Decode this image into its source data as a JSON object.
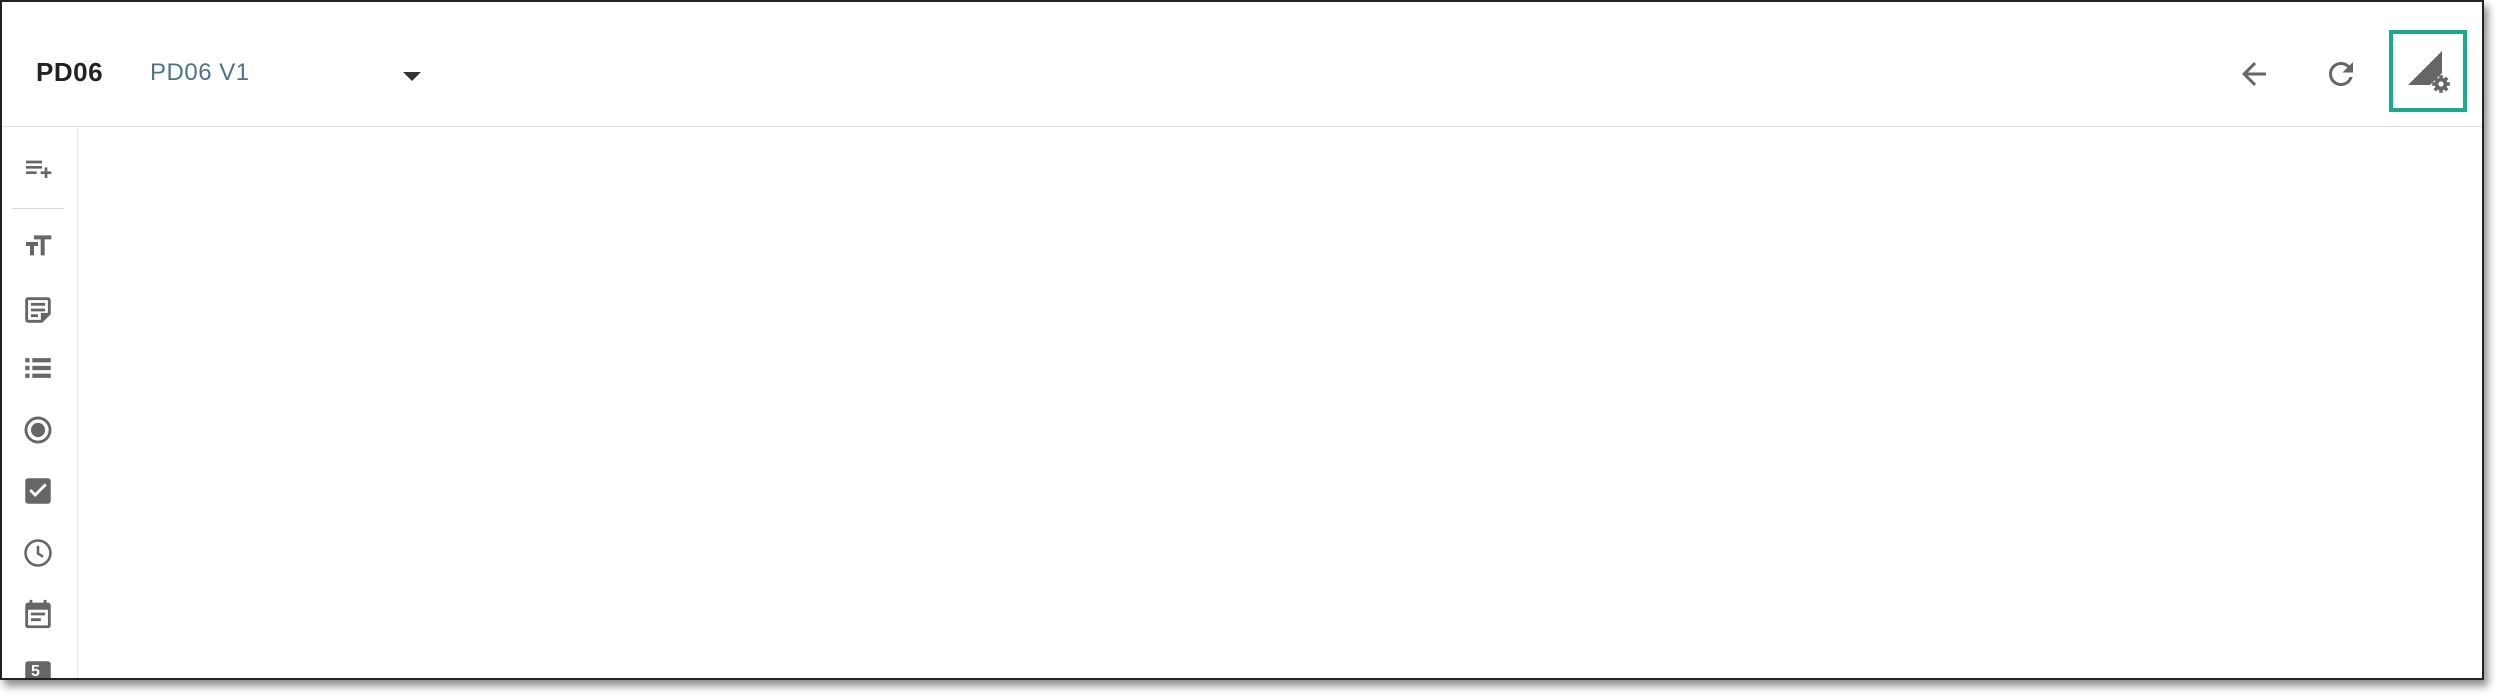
{
  "header": {
    "title": "PD06",
    "version_select": {
      "selected": "PD06 V1"
    },
    "actions": [
      {
        "name": "back-button",
        "icon": "arrow-left-icon"
      },
      {
        "name": "refresh-button",
        "icon": "refresh-icon"
      },
      {
        "name": "settings-button",
        "icon": "signal-settings-icon",
        "highlighted": true
      }
    ],
    "highlight_color": "#1aa98a"
  },
  "sidebar": {
    "items": [
      {
        "name": "add-list-item",
        "icon": "playlist-add-icon"
      },
      {
        "name": "text-size-tool",
        "icon": "text-size-icon"
      },
      {
        "name": "note-tool",
        "icon": "note-icon"
      },
      {
        "name": "list-tool",
        "icon": "list-icon"
      },
      {
        "name": "radio-tool",
        "icon": "radio-button-icon"
      },
      {
        "name": "checkbox-tool",
        "icon": "checkbox-icon"
      },
      {
        "name": "time-tool",
        "icon": "clock-icon"
      },
      {
        "name": "date-tool",
        "icon": "calendar-icon"
      },
      {
        "name": "number-tool",
        "icon": "number-icon",
        "label": "5"
      }
    ]
  },
  "colors": {
    "icon": "#666666",
    "title": "#222222",
    "version_text": "#4d7385"
  }
}
